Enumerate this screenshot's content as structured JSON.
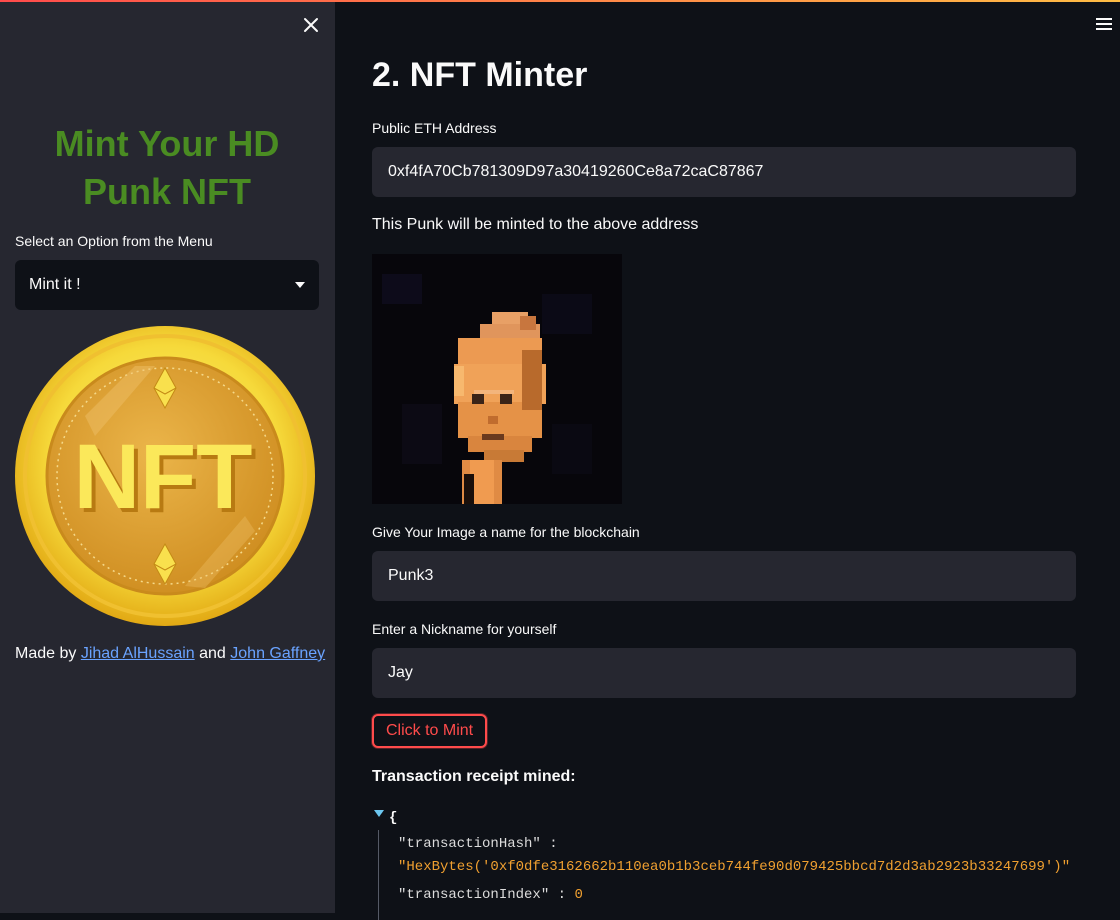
{
  "sidebar": {
    "title": "Mint Your HD Punk NFT",
    "select_label": "Select an Option from the Menu",
    "select_value": "Mint it !",
    "coin_text": "NFT",
    "credits": {
      "prefix": "Made by",
      "author1": "Jihad AlHussain",
      "conj": "and",
      "author2": "John Gaffney"
    }
  },
  "main": {
    "title": "2. NFT Minter",
    "address_label": "Public ETH Address",
    "address_value": "0xf4fA70Cb781309D97a30419260Ce8a72caC87867",
    "minted_info": "This Punk will be minted to the above address",
    "name_label": "Give Your Image a name for the blockchain",
    "name_value": "Punk3",
    "nickname_label": "Enter a Nickname for yourself",
    "nickname_value": "Jay",
    "mint_button": "Click to Mint",
    "receipt_label": "Transaction receipt mined:",
    "receipt": {
      "open_brace": "{",
      "hash_key": "\"transactionHash\" :",
      "hash_value": "\"HexBytes('0xf0dfe3162662b110ea0b1b3ceb744fe90d079425bbcd7d2d3ab2923b33247699')\"",
      "index_key": "\"transactionIndex\" :",
      "index_value": "0"
    }
  },
  "colors": {
    "accent": "#ff4b4b",
    "title_green": "#4a8c22",
    "link": "#6aa3ff",
    "json_value": "#f0a030"
  }
}
